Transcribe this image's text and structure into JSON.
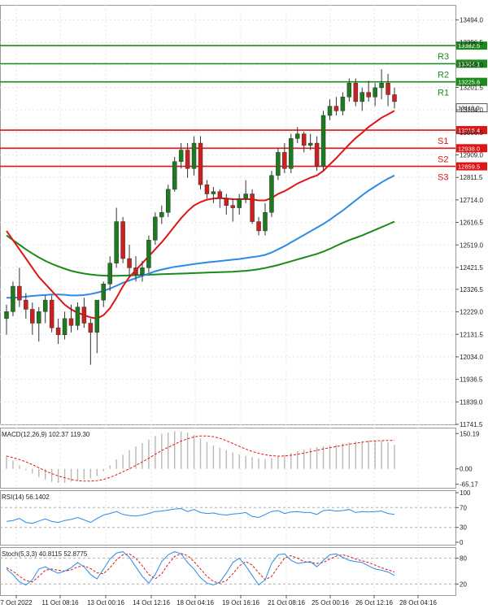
{
  "chart_data": {
    "type": "candlestick",
    "instrument_note": "",
    "colors": {
      "bull": "#1e7a1e",
      "bear": "#cc1f1f",
      "ma_fast": "#e01414",
      "ma_mid": "#2e8ae6",
      "ma_slow": "#1b8a1b",
      "resistance": "#1b8a1b",
      "support": "#e01414",
      "macd_hist": "#b8b8b8",
      "macd_signal": "#e01414",
      "rsi": "#2e8ae6",
      "stoch_k": "#2e8ae6",
      "stoch_d": "#e01414",
      "grid": "#e6e6e6"
    },
    "main": {
      "ylim": [
        11741.5,
        13559.0
      ],
      "y_ticks": [
        "13494.0",
        "13396.5",
        "13299.0",
        "13201.5",
        "13104.0",
        "13006.5",
        "12909.0",
        "12811.5",
        "12714.0",
        "12616.5",
        "12519.0",
        "12421.5",
        "12326.5",
        "12229.0",
        "12131.5",
        "12034.0",
        "11936.5",
        "11839.0",
        "11741.5"
      ],
      "levels": [
        {
          "label": "R3",
          "value": 13382.5,
          "value_text": "13382.5",
          "kind": "resistance"
        },
        {
          "label": "R2",
          "value": 13304.1,
          "value_text": "13304.1",
          "kind": "resistance"
        },
        {
          "label": "R1",
          "value": 13225.6,
          "value_text": "13225.6",
          "kind": "resistance"
        },
        {
          "label": "S1",
          "value": 13016.4,
          "value_text": "13016.4",
          "kind": "support"
        },
        {
          "label": "S2",
          "value": 12938.0,
          "value_text": "12938.0",
          "kind": "support"
        },
        {
          "label": "S3",
          "value": 12859.5,
          "value_text": "12859.5",
          "kind": "support"
        }
      ],
      "current_price": 13113.0,
      "current_price_text": "13113.0",
      "ohlc": [
        [
          12200,
          12260,
          12130,
          12230
        ],
        [
          12230,
          12360,
          12210,
          12340
        ],
        [
          12340,
          12420,
          12250,
          12280
        ],
        [
          12280,
          12310,
          12200,
          12240
        ],
        [
          12240,
          12270,
          12130,
          12180
        ],
        [
          12180,
          12250,
          12100,
          12230
        ],
        [
          12230,
          12300,
          12180,
          12280
        ],
        [
          12280,
          12300,
          12140,
          12160
        ],
        [
          12160,
          12200,
          12090,
          12130
        ],
        [
          12130,
          12230,
          12110,
          12200
        ],
        [
          12200,
          12260,
          12140,
          12170
        ],
        [
          12170,
          12270,
          12150,
          12250
        ],
        [
          12250,
          12290,
          12160,
          12180
        ],
        [
          12180,
          12200,
          12000,
          12140
        ],
        [
          12140,
          12170,
          12050,
          12280
        ],
        [
          12280,
          12360,
          12250,
          12350
        ],
        [
          12350,
          12470,
          12320,
          12440
        ],
        [
          12440,
          12680,
          12420,
          12620
        ],
        [
          12620,
          12640,
          12440,
          12460
        ],
        [
          12460,
          12520,
          12380,
          12420
        ],
        [
          12420,
          12470,
          12360,
          12390
        ],
        [
          12390,
          12450,
          12360,
          12420
        ],
        [
          12420,
          12560,
          12400,
          12540
        ],
        [
          12540,
          12660,
          12520,
          12640
        ],
        [
          12640,
          12690,
          12610,
          12660
        ],
        [
          12660,
          12780,
          12640,
          12760
        ],
        [
          12760,
          12900,
          12750,
          12880
        ],
        [
          12880,
          12960,
          12850,
          12930
        ],
        [
          12930,
          12960,
          12810,
          12850
        ],
        [
          12850,
          12990,
          12820,
          12960
        ],
        [
          12960,
          12990,
          12760,
          12780
        ],
        [
          12780,
          12800,
          12720,
          12740
        ],
        [
          12740,
          12770,
          12700,
          12750
        ],
        [
          12750,
          12760,
          12680,
          12720
        ],
        [
          12720,
          12740,
          12650,
          12690
        ],
        [
          12690,
          12720,
          12620,
          12680
        ],
        [
          12680,
          12740,
          12650,
          12720
        ],
        [
          12720,
          12800,
          12700,
          12740
        ],
        [
          12740,
          12760,
          12610,
          12620
        ],
        [
          12620,
          12640,
          12560,
          12580
        ],
        [
          12580,
          12700,
          12560,
          12660
        ],
        [
          12660,
          12840,
          12640,
          12820
        ],
        [
          12820,
          12940,
          12800,
          12920
        ],
        [
          12920,
          12960,
          12830,
          12850
        ],
        [
          12850,
          13000,
          12830,
          12980
        ],
        [
          12980,
          13030,
          12960,
          13000
        ],
        [
          13000,
          13010,
          12920,
          12950
        ],
        [
          12950,
          13000,
          12930,
          12960
        ],
        [
          12960,
          12990,
          12840,
          12860
        ],
        [
          12860,
          13100,
          12840,
          13080
        ],
        [
          13080,
          13150,
          13060,
          13120
        ],
        [
          13120,
          13160,
          13080,
          13100
        ],
        [
          13100,
          13180,
          13080,
          13160
        ],
        [
          13160,
          13240,
          13140,
          13220
        ],
        [
          13220,
          13240,
          13120,
          13140
        ],
        [
          13140,
          13200,
          13100,
          13180
        ],
        [
          13180,
          13230,
          13140,
          13160
        ],
        [
          13160,
          13220,
          13120,
          13200
        ],
        [
          13200,
          13280,
          13150,
          13220
        ],
        [
          13220,
          13260,
          13120,
          13170
        ],
        [
          13170,
          13200,
          13110,
          13140
        ]
      ],
      "ma_fast": [
        12580,
        12540,
        12500,
        12460,
        12420,
        12380,
        12350,
        12320,
        12290,
        12260,
        12240,
        12225,
        12215,
        12205,
        12200,
        12215,
        12245,
        12290,
        12340,
        12380,
        12410,
        12440,
        12470,
        12500,
        12530,
        12565,
        12600,
        12635,
        12665,
        12690,
        12705,
        12715,
        12720,
        12722,
        12720,
        12717,
        12716,
        12718,
        12716,
        12712,
        12712,
        12722,
        12740,
        12752,
        12768,
        12785,
        12798,
        12810,
        12820,
        12840,
        12868,
        12895,
        12925,
        12955,
        12982,
        13005,
        13030,
        13050,
        13070,
        13085,
        13100
      ],
      "ma_mid": [
        12290,
        12290,
        12292,
        12295,
        12298,
        12300,
        12302,
        12304,
        12304,
        12303,
        12300,
        12300,
        12302,
        12306,
        12312,
        12320,
        12330,
        12342,
        12355,
        12365,
        12375,
        12385,
        12395,
        12405,
        12412,
        12418,
        12424,
        12428,
        12432,
        12436,
        12440,
        12443,
        12446,
        12449,
        12452,
        12455,
        12458,
        12462,
        12466,
        12470,
        12476,
        12486,
        12500,
        12514,
        12530,
        12546,
        12562,
        12578,
        12594,
        12610,
        12628,
        12648,
        12668,
        12690,
        12712,
        12734,
        12754,
        12772,
        12790,
        12806,
        12820
      ],
      "ma_slow": [
        12560,
        12540,
        12520,
        12500,
        12482,
        12465,
        12450,
        12437,
        12426,
        12416,
        12407,
        12400,
        12395,
        12391,
        12388,
        12386,
        12385,
        12385,
        12386,
        12387,
        12388,
        12389,
        12390,
        12391,
        12392,
        12393,
        12394,
        12395,
        12396,
        12397,
        12398,
        12399,
        12400,
        12401,
        12402,
        12403,
        12405,
        12407,
        12410,
        12414,
        12419,
        12425,
        12432,
        12440,
        12448,
        12456,
        12464,
        12472,
        12480,
        12490,
        12502,
        12515,
        12528,
        12540,
        12550,
        12560,
        12572,
        12584,
        12596,
        12608,
        12620
      ]
    },
    "macd": {
      "label": "MACD(12,26,9) 102.37 119.30",
      "y_ticks": [
        "150.19",
        "0.00",
        "-65.17"
      ],
      "ylim": [
        -70,
        165
      ],
      "histogram": [
        55,
        35,
        15,
        -5,
        -20,
        -35,
        -45,
        -55,
        -60,
        -60,
        -55,
        -50,
        -45,
        -40,
        -30,
        -10,
        15,
        40,
        60,
        80,
        95,
        110,
        125,
        140,
        150,
        155,
        160,
        160,
        155,
        145,
        130,
        115,
        100,
        90,
        80,
        70,
        62,
        55,
        50,
        45,
        42,
        45,
        52,
        60,
        68,
        75,
        82,
        88,
        92,
        96,
        100,
        104,
        108,
        112,
        116,
        118,
        120,
        120,
        118,
        112,
        102
      ],
      "signal": [
        55,
        48,
        40,
        30,
        18,
        5,
        -8,
        -20,
        -30,
        -38,
        -45,
        -50,
        -52,
        -52,
        -50,
        -45,
        -36,
        -25,
        -12,
        0,
        15,
        30,
        45,
        62,
        78,
        92,
        105,
        118,
        128,
        136,
        140,
        140,
        137,
        130,
        120,
        108,
        96,
        84,
        74,
        66,
        60,
        56,
        54,
        55,
        58,
        62,
        67,
        73,
        79,
        85,
        90,
        95,
        100,
        105,
        109,
        113,
        117,
        119,
        120,
        121,
        121
      ]
    },
    "rsi": {
      "label": "RSI(14) 56.1402",
      "y_ticks": [
        "100",
        "70",
        "30",
        "0"
      ],
      "ylim": [
        0,
        100
      ],
      "values": [
        42,
        44,
        48,
        40,
        38,
        43,
        47,
        42,
        40,
        44,
        46,
        50,
        45,
        40,
        48,
        55,
        58,
        62,
        56,
        54,
        53,
        55,
        58,
        62,
        63,
        65,
        67,
        68,
        62,
        66,
        60,
        58,
        59,
        56,
        55,
        57,
        58,
        60,
        52,
        50,
        56,
        62,
        64,
        58,
        61,
        62,
        60,
        60,
        56,
        64,
        65,
        63,
        64,
        66,
        60,
        62,
        61,
        62,
        63,
        58,
        56
      ]
    },
    "stoch": {
      "label": "Stoch(5,3,3) 40.8115 52.8775",
      "y_ticks": [
        "80",
        "20"
      ],
      "ylim": [
        0,
        100
      ],
      "k": [
        55,
        42,
        25,
        18,
        30,
        55,
        60,
        52,
        45,
        50,
        58,
        70,
        60,
        42,
        32,
        55,
        78,
        92,
        95,
        82,
        60,
        38,
        22,
        42,
        72,
        88,
        95,
        90,
        70,
        55,
        35,
        22,
        18,
        25,
        45,
        70,
        80,
        62,
        40,
        18,
        30,
        68,
        88,
        90,
        75,
        68,
        70,
        72,
        60,
        75,
        88,
        90,
        82,
        75,
        72,
        70,
        62,
        55,
        52,
        48,
        40
      ],
      "d": [
        58,
        50,
        38,
        28,
        25,
        38,
        52,
        55,
        52,
        50,
        53,
        60,
        62,
        56,
        46,
        44,
        58,
        76,
        88,
        90,
        80,
        62,
        42,
        32,
        44,
        66,
        84,
        91,
        86,
        72,
        55,
        38,
        26,
        22,
        28,
        44,
        62,
        72,
        64,
        46,
        30,
        38,
        60,
        80,
        86,
        80,
        72,
        70,
        68,
        70,
        78,
        85,
        88,
        84,
        78,
        74,
        70,
        64,
        58,
        53,
        48
      ]
    },
    "x_labels": [
      "7 Oct 2022",
      "11 Oct 08:16",
      "13 Oct 00:16",
      "14 Oct 12:16",
      "18 Oct 04:16",
      "19 Oct 16:16",
      "21 Oct 08:16",
      "25 Oct 00:16",
      "26 Oct 12:16",
      "28 Oct 04:16"
    ]
  }
}
